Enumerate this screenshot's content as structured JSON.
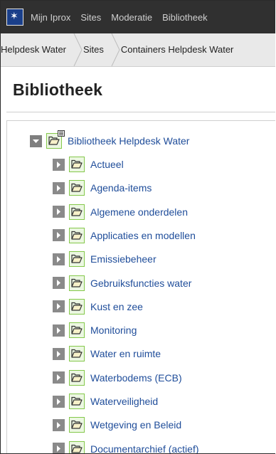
{
  "topnav": {
    "items": [
      "Mijn Iprox",
      "Sites",
      "Moderatie",
      "Bibliotheek"
    ]
  },
  "breadcrumb": [
    "Helpdesk Water",
    "Sites",
    "Containers Helpdesk Water"
  ],
  "page": {
    "title": "Bibliotheek"
  },
  "tree": {
    "root": "Bibliotheek Helpdesk Water",
    "children": [
      "Actueel",
      "Agenda-items",
      "Algemene onderdelen",
      "Applicaties en modellen",
      "Emissiebeheer",
      "Gebruiksfuncties water",
      "Kust en zee",
      "Monitoring",
      "Water en ruimte",
      "Waterbodems (ECB)",
      "Waterveiligheid",
      "Wetgeving en Beleid",
      "Documentarchief (actief)"
    ]
  }
}
